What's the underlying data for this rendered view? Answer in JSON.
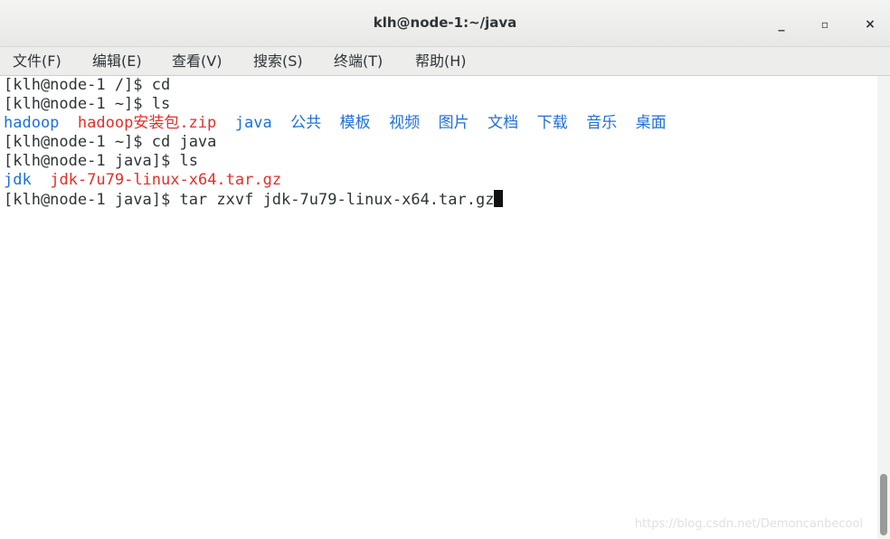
{
  "window": {
    "title": "klh@node-1:~/java",
    "minimize_label": "_",
    "maximize_label": "▫",
    "close_label": "×"
  },
  "menubar": {
    "items": [
      {
        "label": "文件(F)"
      },
      {
        "label": "编辑(E)"
      },
      {
        "label": "查看(V)"
      },
      {
        "label": "搜索(S)"
      },
      {
        "label": "终端(T)"
      },
      {
        "label": "帮助(H)"
      }
    ]
  },
  "terminal": {
    "lines": [
      {
        "text": "[klh@node-1 /]$ cd"
      },
      {
        "text": "[klh@node-1 ~]$ ls"
      },
      {
        "entries": [
          {
            "text": "hadoop",
            "color": "#1e6fd9"
          },
          {
            "text": "hadoop安装包.zip",
            "color": "#e0302a"
          },
          {
            "text": "java",
            "color": "#1e6fd9"
          },
          {
            "text": "公共",
            "color": "#1e6fd9"
          },
          {
            "text": "模板",
            "color": "#1e6fd9"
          },
          {
            "text": "视频",
            "color": "#1e6fd9"
          },
          {
            "text": "图片",
            "color": "#1e6fd9"
          },
          {
            "text": "文档",
            "color": "#1e6fd9"
          },
          {
            "text": "下载",
            "color": "#1e6fd9"
          },
          {
            "text": "音乐",
            "color": "#1e6fd9"
          },
          {
            "text": "桌面",
            "color": "#1e6fd9"
          }
        ]
      },
      {
        "text": "[klh@node-1 ~]$ cd java"
      },
      {
        "text": "[klh@node-1 java]$ ls"
      },
      {
        "entries": [
          {
            "text": "jdk",
            "color": "#1e6fd9"
          },
          {
            "text": "jdk-7u79-linux-x64.tar.gz",
            "color": "#e0302a"
          }
        ]
      },
      {
        "text": "[klh@node-1 java]$ tar zxvf jdk-7u79-linux-x64.tar.gz"
      }
    ]
  },
  "watermark": "https://blog.csdn.net/Demoncanbecool"
}
